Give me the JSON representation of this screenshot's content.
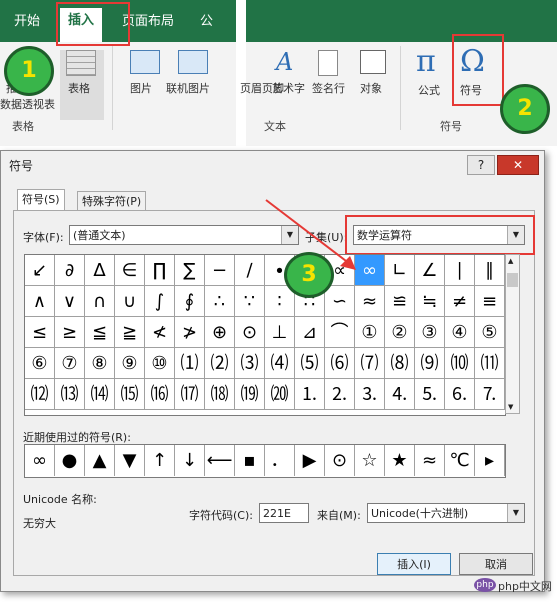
{
  "ribbon": {
    "tabs": [
      "开始",
      "插入",
      "页面布局",
      "公"
    ],
    "buttons": {
      "pivot": "数据透视表",
      "pivot_top": "推",
      "table": "表格",
      "picture": "图片",
      "online_picture": "联机图片",
      "header_footer": "页眉页脚",
      "wordart": "艺术字",
      "signature": "签名行",
      "object": "对象",
      "equation": "公式",
      "symbol": "符号"
    },
    "groups": {
      "table_group": "表格",
      "text_group": "文本",
      "symbol_group": "符号"
    },
    "steps": [
      "1",
      "2",
      "3"
    ]
  },
  "dialog": {
    "title": "符号",
    "help": "?",
    "close": "✕",
    "tabs": [
      "符号(S)",
      "特殊字符(P)"
    ],
    "font_label": "字体(F):",
    "font_value": "(普通文本)",
    "subset_label": "子集(U):",
    "subset_value": "数学运算符",
    "symbols": [
      [
        "↙",
        "∂",
        "∆",
        "∈",
        "∏",
        "∑",
        "−",
        "∕",
        "∙",
        "√",
        "∝",
        "∞",
        "∟",
        "∠",
        "∣",
        "∥"
      ],
      [
        "∧",
        "∨",
        "∩",
        "∪",
        "∫",
        "∮",
        "∴",
        "∵",
        "∶",
        "∷",
        "∽",
        "≈",
        "≌",
        "≒",
        "≠",
        "≡"
      ],
      [
        "≤",
        "≥",
        "≦",
        "≧",
        "≮",
        "≯",
        "⊕",
        "⊙",
        "⊥",
        "⊿",
        "⌒",
        "①",
        "②",
        "③",
        "④",
        "⑤"
      ],
      [
        "⑥",
        "⑦",
        "⑧",
        "⑨",
        "⑩",
        "⑴",
        "⑵",
        "⑶",
        "⑷",
        "⑸",
        "⑹",
        "⑺",
        "⑻",
        "⑼",
        "⑽",
        "⑾"
      ],
      [
        "⑿",
        "⒀",
        "⒁",
        "⒂",
        "⒃",
        "⒄",
        "⒅",
        "⒆",
        "⒇",
        "⒈",
        "⒉",
        "⒊",
        "⒋",
        "⒌",
        "⒍",
        "⒎"
      ]
    ],
    "recent_label": "近期使用过的符号(R):",
    "recent": [
      "∞",
      "●",
      "▲",
      "▼",
      "↑",
      "↓",
      "⟵",
      "▪",
      "．",
      "▶",
      "⊙",
      "☆",
      "★",
      "≈",
      "℃",
      "▸"
    ],
    "unicode_name_label": "Unicode 名称:",
    "unicode_name": "无穷大",
    "char_code_label": "字符代码(C):",
    "char_code": "221E",
    "from_label": "来自(M):",
    "from_value": "Unicode(十六进制)",
    "insert": "插入(I)",
    "cancel": "取消"
  },
  "watermark": "php中文网",
  "colors": {
    "excel_green": "#217346",
    "highlight": "#3399ff",
    "annotation_red": "#e53935",
    "step_green": "#39b54a"
  }
}
